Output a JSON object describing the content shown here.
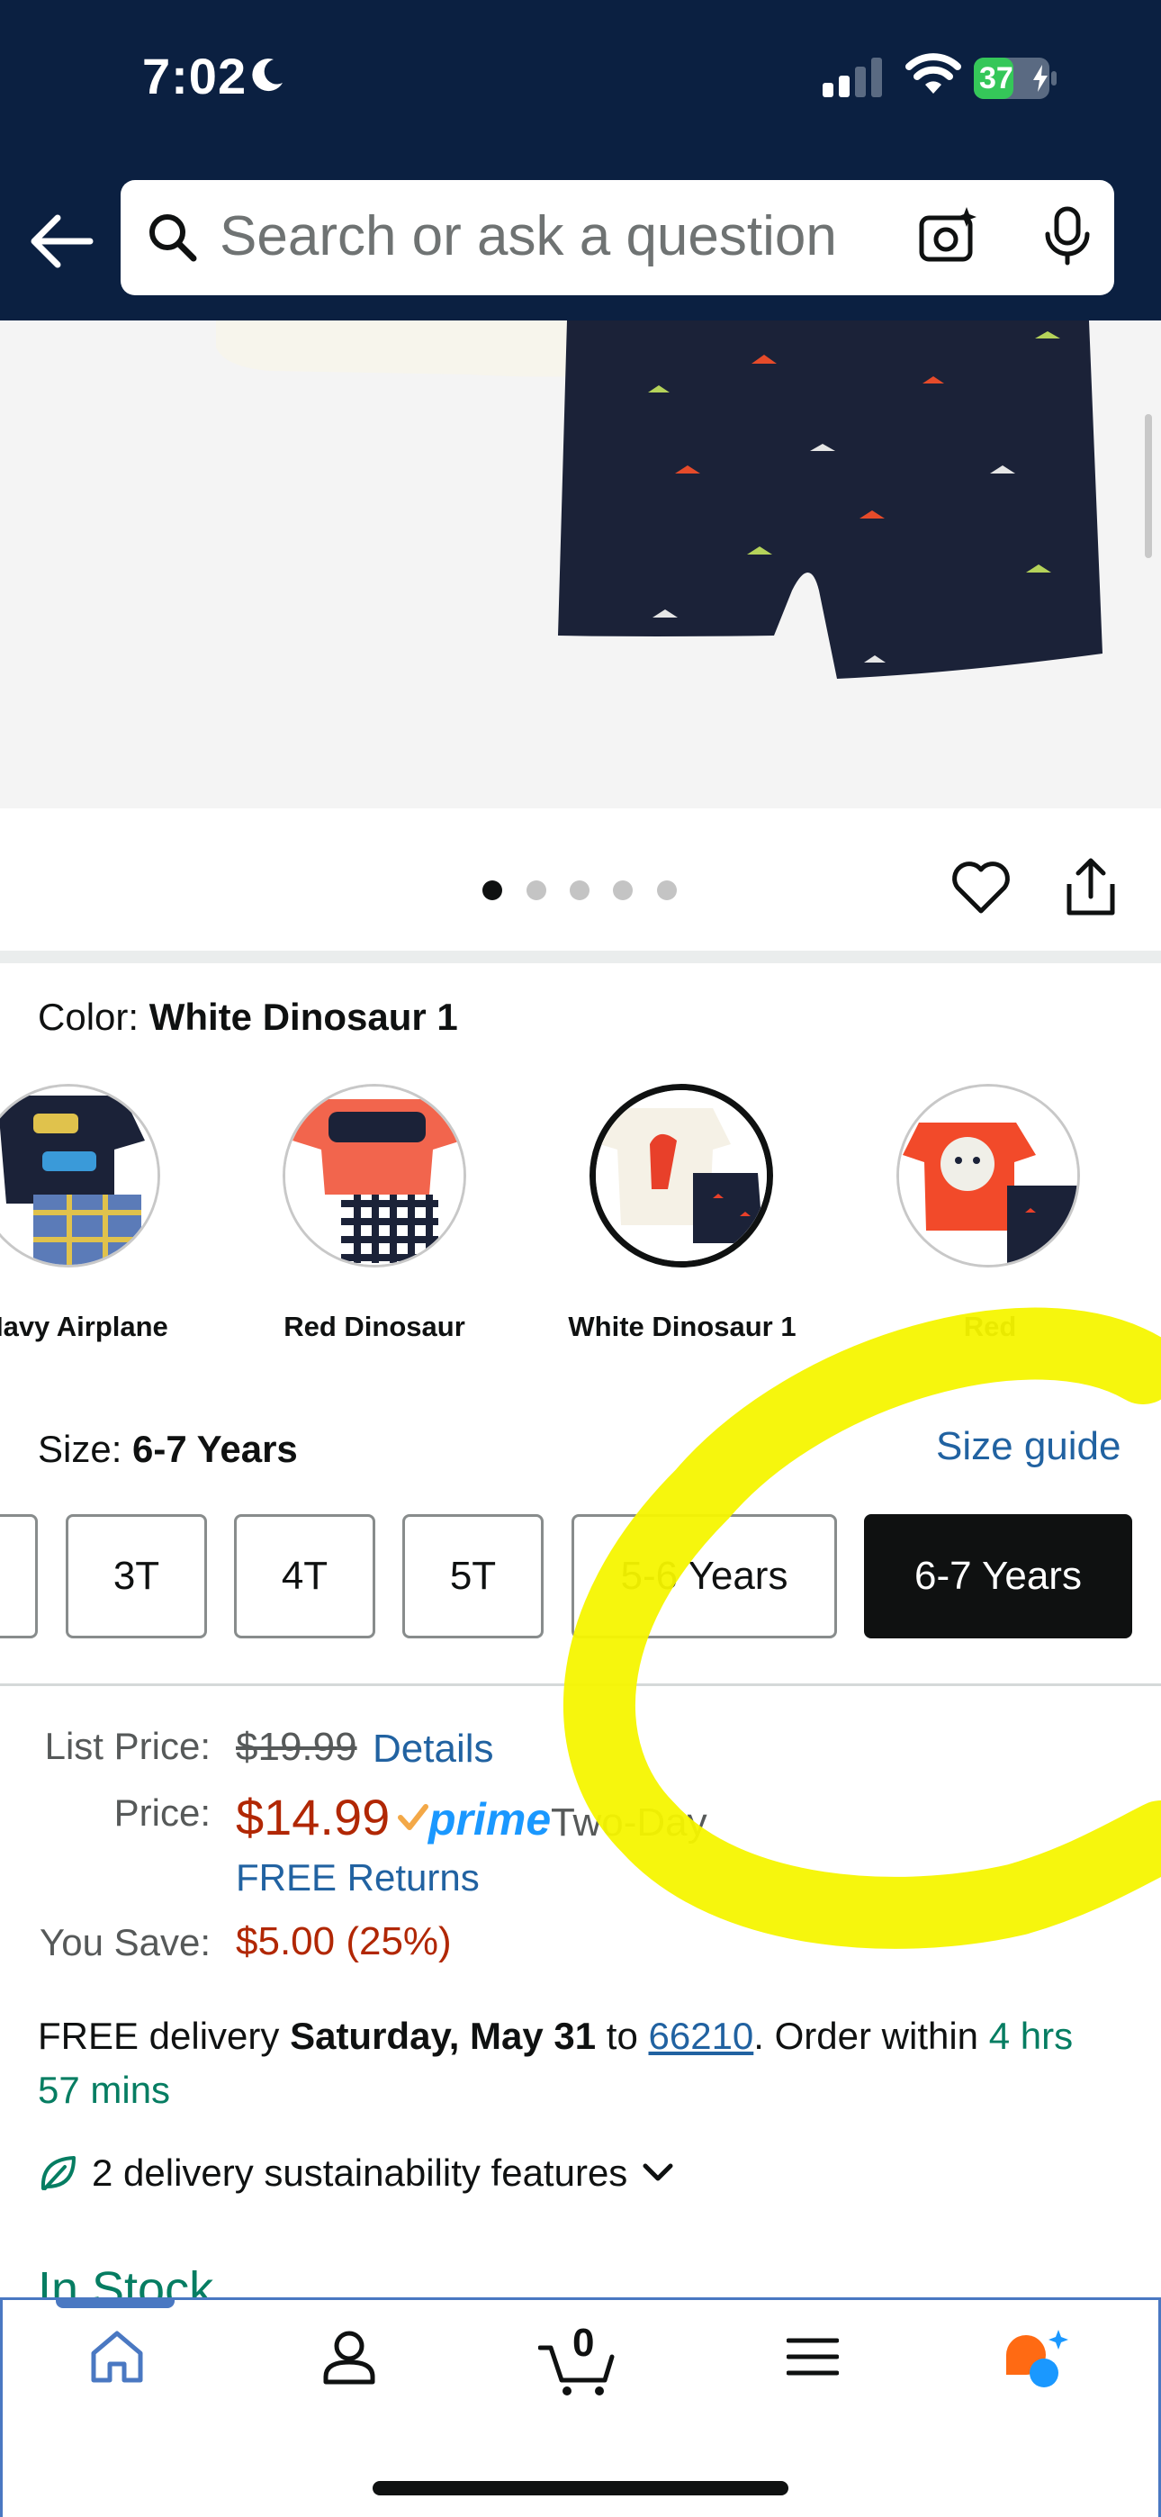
{
  "status_bar": {
    "time": "7:02",
    "battery": "37"
  },
  "search": {
    "placeholder": "Search or ask a question"
  },
  "carousel": {
    "dot_count": 5,
    "active_dot": 0
  },
  "color": {
    "label": "Color:",
    "selected": "White Dinosaur 1",
    "options": [
      {
        "label": "Navy Airplane"
      },
      {
        "label": "Red Dinosaur"
      },
      {
        "label": "White Dinosaur 1",
        "selected": true
      },
      {
        "label": "Red"
      }
    ]
  },
  "size": {
    "label": "Size:",
    "selected": "6-7 Years",
    "guide_link": "Size guide",
    "options": [
      "3T",
      "4T",
      "5T",
      "5-6 Years",
      "6-7 Years"
    ]
  },
  "pricing": {
    "list_price_label": "List Price:",
    "list_price": "$19.99",
    "details_link": "Details",
    "price_label": "Price:",
    "price": "$14.99",
    "prime_text": "prime",
    "shipping_speed": "Two-Day",
    "free_returns": "FREE Returns",
    "you_save_label": "You Save:",
    "you_save": "$5.00 (25%)"
  },
  "delivery": {
    "prefix": "FREE delivery",
    "date": "Saturday, May 31",
    "to": "to",
    "zip": "66210",
    "order_within": ". Order within",
    "cutoff": "4 hrs 57 mins",
    "sustainability": "2 delivery sustainability features"
  },
  "stock": {
    "status": "In Stock"
  },
  "bottom_nav": {
    "cart_count": "0"
  },
  "colors": {
    "header_bg": "#0b2041",
    "price_red": "#b12704",
    "link_blue": "#2162a1",
    "prime_blue": "#1a98ff",
    "stock_green": "#067d62",
    "nav_accent": "#4a78c2",
    "highlight_yellow": "#f5f500"
  }
}
